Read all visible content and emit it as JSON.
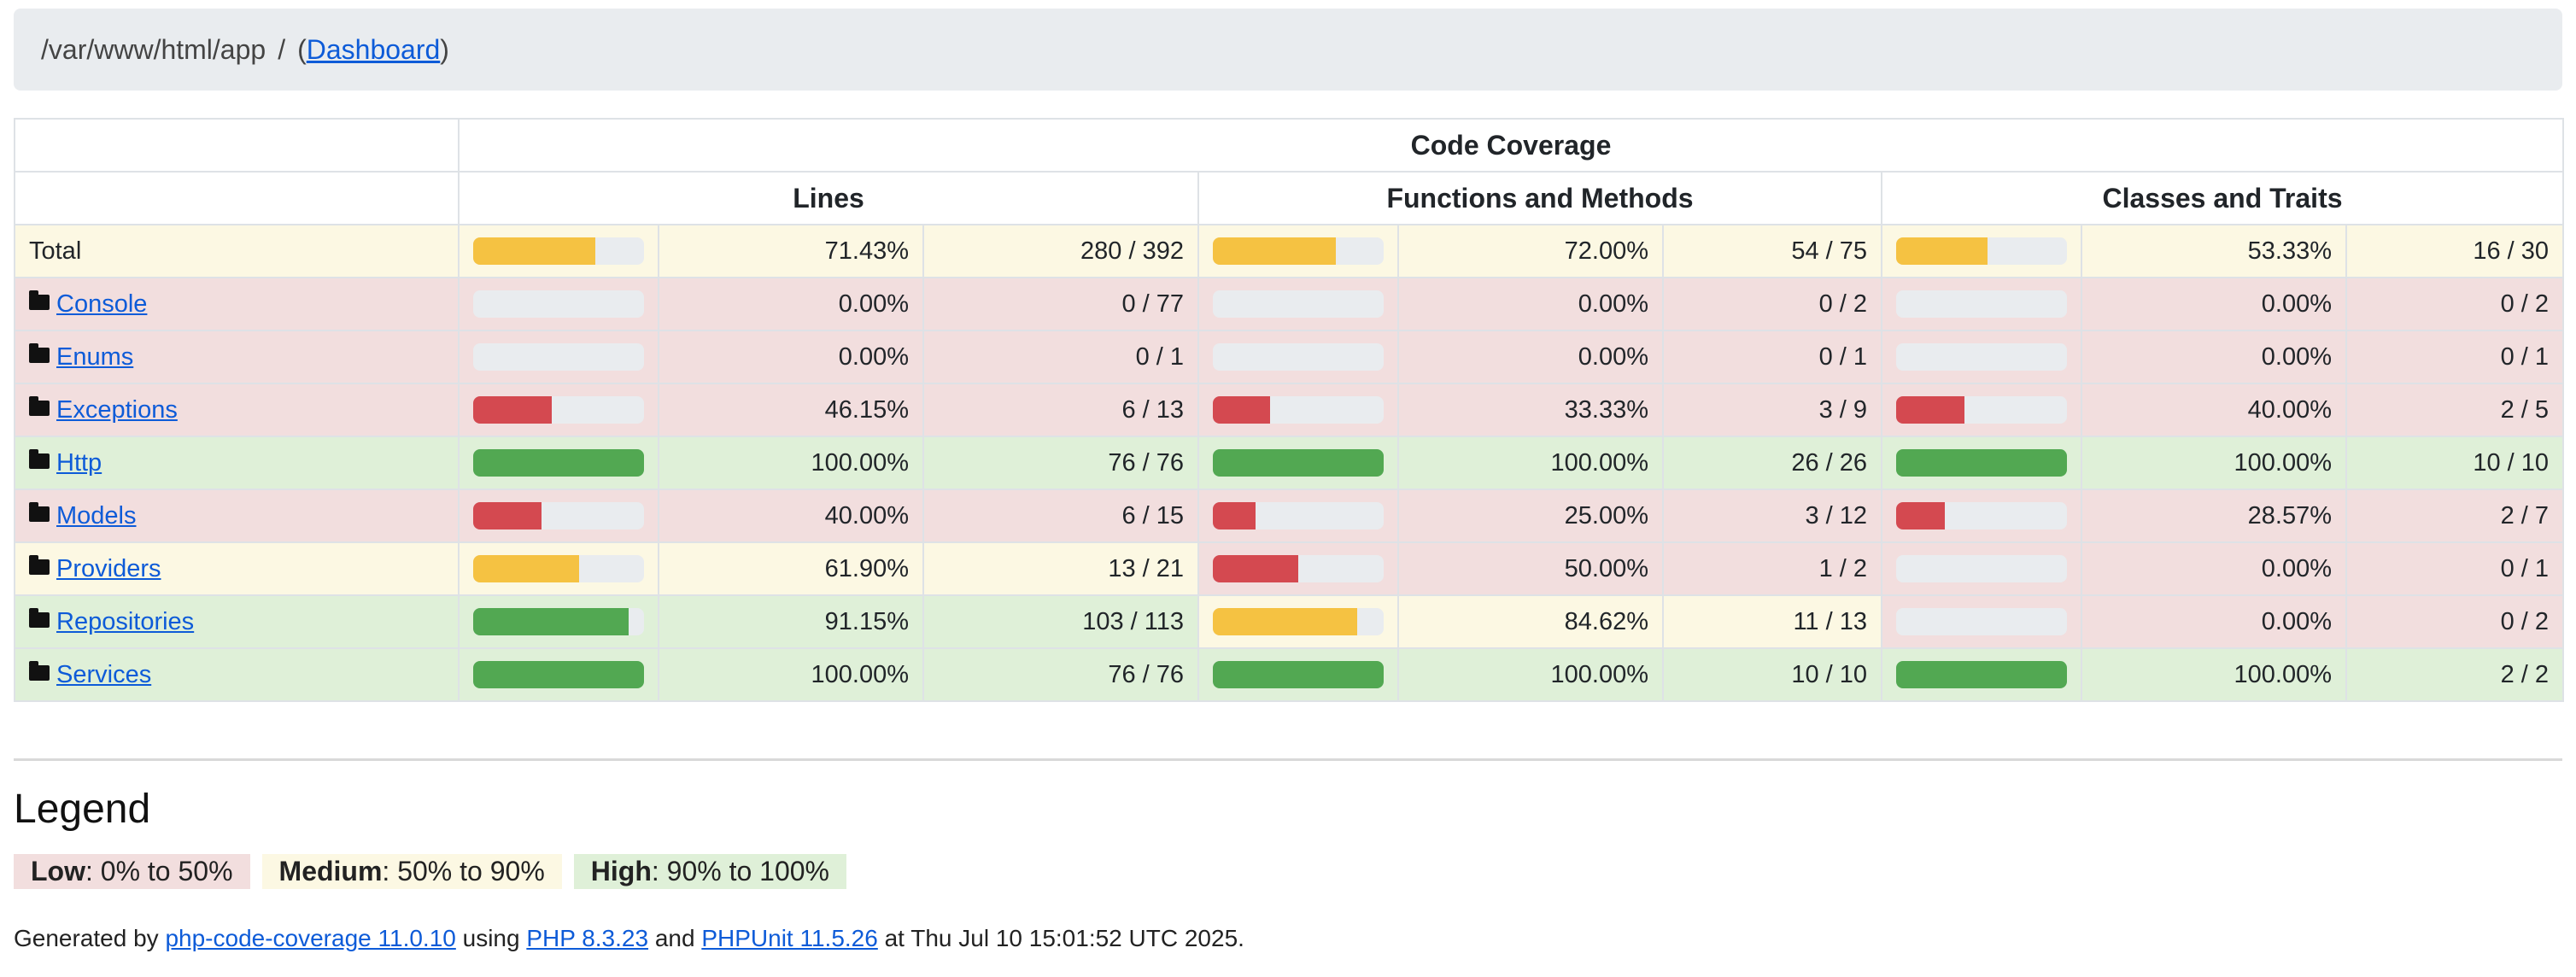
{
  "breadcrumb": {
    "path": "/var/www/html/app",
    "separator": "/",
    "dashboard_link": "Dashboard"
  },
  "table": {
    "header_main": "Code Coverage",
    "header_lines": "Lines",
    "header_functions": "Functions and Methods",
    "header_classes": "Classes and Traits",
    "rows": [
      {
        "name": "Total",
        "is_link": false,
        "lines": {
          "pct": "71.43%",
          "ratio": "280 / 392",
          "level": "medium",
          "value": 71.43
        },
        "functions": {
          "pct": "72.00%",
          "ratio": "54 / 75",
          "level": "medium",
          "value": 72.0
        },
        "classes": {
          "pct": "53.33%",
          "ratio": "16 / 30",
          "level": "medium",
          "value": 53.33
        }
      },
      {
        "name": "Console",
        "is_link": true,
        "lines": {
          "pct": "0.00%",
          "ratio": "0 / 77",
          "level": "low",
          "value": 0
        },
        "functions": {
          "pct": "0.00%",
          "ratio": "0 / 2",
          "level": "low",
          "value": 0
        },
        "classes": {
          "pct": "0.00%",
          "ratio": "0 / 2",
          "level": "low",
          "value": 0
        }
      },
      {
        "name": "Enums",
        "is_link": true,
        "lines": {
          "pct": "0.00%",
          "ratio": "0 / 1",
          "level": "low",
          "value": 0
        },
        "functions": {
          "pct": "0.00%",
          "ratio": "0 / 1",
          "level": "low",
          "value": 0
        },
        "classes": {
          "pct": "0.00%",
          "ratio": "0 / 1",
          "level": "low",
          "value": 0
        }
      },
      {
        "name": "Exceptions",
        "is_link": true,
        "lines": {
          "pct": "46.15%",
          "ratio": "6 / 13",
          "level": "low",
          "value": 46.15
        },
        "functions": {
          "pct": "33.33%",
          "ratio": "3 / 9",
          "level": "low",
          "value": 33.33
        },
        "classes": {
          "pct": "40.00%",
          "ratio": "2 / 5",
          "level": "low",
          "value": 40.0
        }
      },
      {
        "name": "Http",
        "is_link": true,
        "lines": {
          "pct": "100.00%",
          "ratio": "76 / 76",
          "level": "high",
          "value": 100
        },
        "functions": {
          "pct": "100.00%",
          "ratio": "26 / 26",
          "level": "high",
          "value": 100
        },
        "classes": {
          "pct": "100.00%",
          "ratio": "10 / 10",
          "level": "high",
          "value": 100
        }
      },
      {
        "name": "Models",
        "is_link": true,
        "lines": {
          "pct": "40.00%",
          "ratio": "6 / 15",
          "level": "low",
          "value": 40.0
        },
        "functions": {
          "pct": "25.00%",
          "ratio": "3 / 12",
          "level": "low",
          "value": 25.0
        },
        "classes": {
          "pct": "28.57%",
          "ratio": "2 / 7",
          "level": "low",
          "value": 28.57
        }
      },
      {
        "name": "Providers",
        "is_link": true,
        "lines": {
          "pct": "61.90%",
          "ratio": "13 / 21",
          "level": "medium",
          "value": 61.9
        },
        "functions": {
          "pct": "50.00%",
          "ratio": "1 / 2",
          "level": "low",
          "value": 50.0
        },
        "classes": {
          "pct": "0.00%",
          "ratio": "0 / 1",
          "level": "low",
          "value": 0
        }
      },
      {
        "name": "Repositories",
        "is_link": true,
        "lines": {
          "pct": "91.15%",
          "ratio": "103 / 113",
          "level": "high",
          "value": 91.15
        },
        "functions": {
          "pct": "84.62%",
          "ratio": "11 / 13",
          "level": "medium",
          "value": 84.62
        },
        "classes": {
          "pct": "0.00%",
          "ratio": "0 / 2",
          "level": "low",
          "value": 0
        }
      },
      {
        "name": "Services",
        "is_link": true,
        "lines": {
          "pct": "100.00%",
          "ratio": "76 / 76",
          "level": "high",
          "value": 100
        },
        "functions": {
          "pct": "100.00%",
          "ratio": "10 / 10",
          "level": "high",
          "value": 100
        },
        "classes": {
          "pct": "100.00%",
          "ratio": "2 / 2",
          "level": "high",
          "value": 100
        }
      }
    ]
  },
  "legend": {
    "title": "Legend",
    "low_label": "Low",
    "low_range": ": 0% to 50%",
    "medium_label": "Medium",
    "medium_range": ": 50% to 90%",
    "high_label": "High",
    "high_range": ": 90% to 100%"
  },
  "footer": {
    "generated_by": "Generated by ",
    "tool_link": "php-code-coverage 11.0.10",
    "using": " using ",
    "php_link": "PHP 8.3.23",
    "and": " and ",
    "phpunit_link": "PHPUnit 11.5.26",
    "at": " at Thu Jul 10 15:01:52 UTC 2025."
  },
  "colors": {
    "low": "#f2dede",
    "medium": "#fcf8e3",
    "high": "#dff0d8",
    "bar_low": "#d44950",
    "bar_medium": "#f5c242",
    "bar_high": "#52a852"
  }
}
